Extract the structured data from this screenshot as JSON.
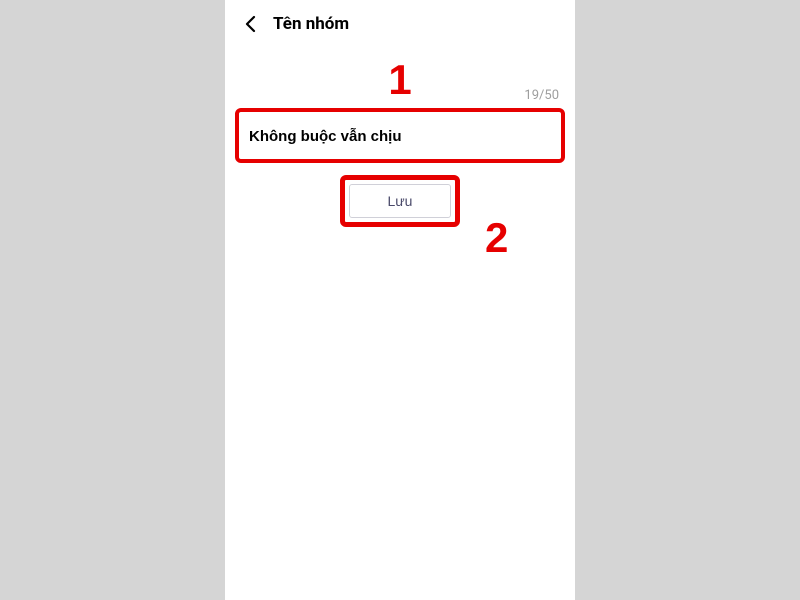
{
  "header": {
    "title": "Tên nhóm"
  },
  "input": {
    "value": "Không buộc vẫn chịu",
    "counter": "19/50"
  },
  "button": {
    "save_label": "Lưu"
  },
  "annotations": {
    "one": "1",
    "two": "2"
  }
}
